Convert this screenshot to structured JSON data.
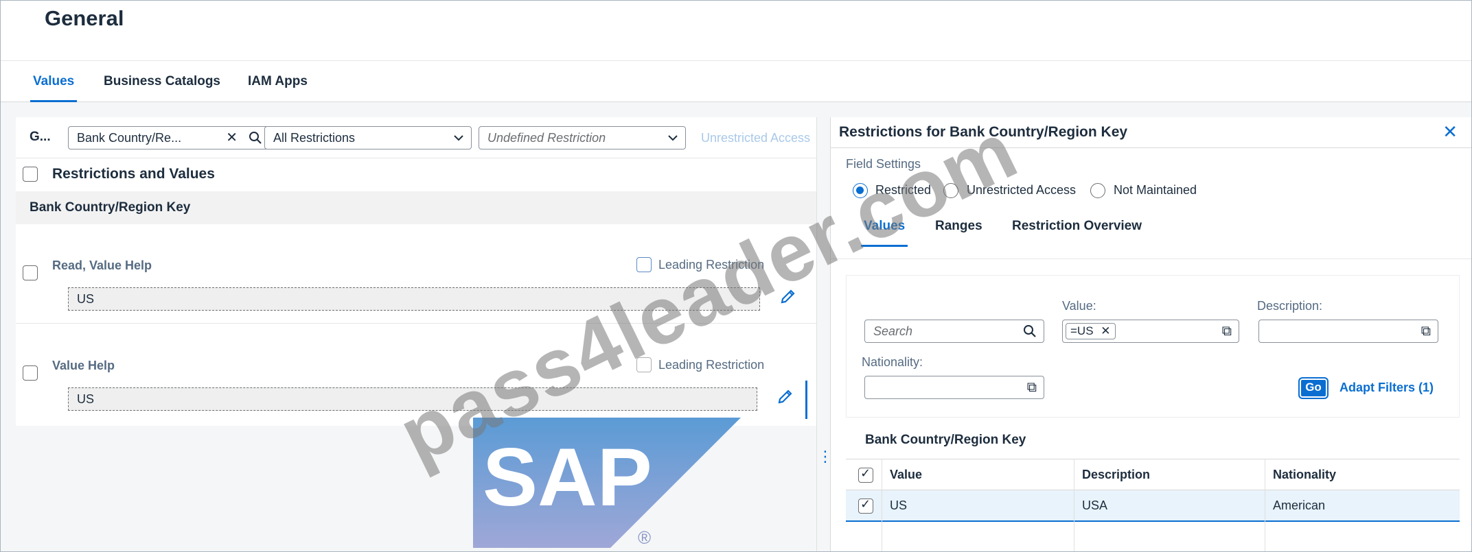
{
  "page": {
    "title": "General"
  },
  "tabs": [
    {
      "label": "Values",
      "active": true
    },
    {
      "label": "Business Catalogs",
      "active": false
    },
    {
      "label": "IAM Apps",
      "active": false
    }
  ],
  "left": {
    "group_short": "G...",
    "search_value": "Bank Country/Re...",
    "restriction_select": "All Restrictions",
    "undefined_select": "Undefined Restriction",
    "unrestricted_label": "Unrestricted Access",
    "list_title": "Restrictions and Values",
    "group_header": "Bank Country/Region Key",
    "items": [
      {
        "label": "Read, Value Help",
        "leading": "Leading Restriction",
        "value": "US"
      },
      {
        "label": "Value Help",
        "leading": "Leading Restriction",
        "value": "US"
      }
    ]
  },
  "right": {
    "title": "Restrictions for Bank Country/Region Key",
    "field_settings_label": "Field Settings",
    "radios": [
      {
        "label": "Restricted",
        "selected": true
      },
      {
        "label": "Unrestricted Access",
        "selected": false
      },
      {
        "label": "Not Maintained",
        "selected": false
      }
    ],
    "tabs": [
      {
        "label": "Values",
        "active": true
      },
      {
        "label": "Ranges",
        "active": false
      },
      {
        "label": "Restriction Overview",
        "active": false
      }
    ],
    "filters": {
      "search_placeholder": "Search",
      "value_label": "Value:",
      "value_token": "=US",
      "description_label": "Description:",
      "nationality_label": "Nationality:",
      "go_label": "Go",
      "adapt_label": "Adapt Filters (1)"
    },
    "table": {
      "title": "Bank Country/Region Key",
      "columns": [
        "Value",
        "Description",
        "Nationality"
      ],
      "rows": [
        {
          "value": "US",
          "description": "USA",
          "nationality": "American",
          "selected": true
        }
      ]
    }
  },
  "watermark": {
    "text": "pass4leader.com",
    "logo_text": "SAP"
  },
  "colors": {
    "accent": "#0a6ed1",
    "badge_top": "#5b9bd5",
    "badge_bottom": "#9fa7d7"
  }
}
